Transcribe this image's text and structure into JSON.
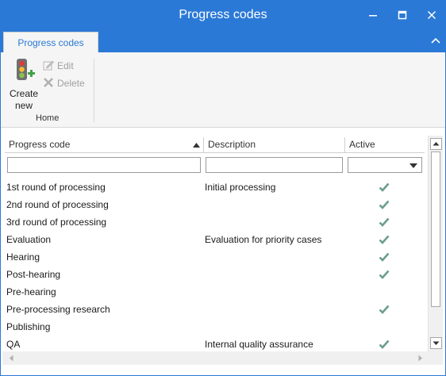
{
  "window": {
    "title": "Progress codes"
  },
  "ribbon": {
    "tab_label": "Progress codes",
    "create_label_1": "Create",
    "create_label_2": "new",
    "edit_label": "Edit",
    "delete_label": "Delete",
    "group_label": "Home",
    "create_icon": "traffic-light-plus-icon",
    "edit_icon": "pencil-icon",
    "delete_icon": "x-icon"
  },
  "grid": {
    "columns": [
      "Progress code",
      "Description",
      "Active"
    ],
    "filter_code": "",
    "filter_desc": "",
    "filter_active": "",
    "rows": [
      {
        "code": "1st round of processing",
        "description": "Initial processing",
        "active": true
      },
      {
        "code": "2nd round of processing",
        "description": "",
        "active": true
      },
      {
        "code": "3rd round of processing",
        "description": "",
        "active": true
      },
      {
        "code": "Evaluation",
        "description": "Evaluation for priority cases",
        "active": true
      },
      {
        "code": "Hearing",
        "description": "",
        "active": true
      },
      {
        "code": "Post-hearing",
        "description": "",
        "active": true
      },
      {
        "code": "Pre-hearing",
        "description": "",
        "active": false
      },
      {
        "code": "Pre-processing research",
        "description": "",
        "active": true
      },
      {
        "code": "Publishing",
        "description": "",
        "active": false
      },
      {
        "code": "QA",
        "description": "Internal quality assurance",
        "active": true
      }
    ]
  },
  "colors": {
    "accent": "#2b79d6",
    "check": "#6b9e8a"
  }
}
